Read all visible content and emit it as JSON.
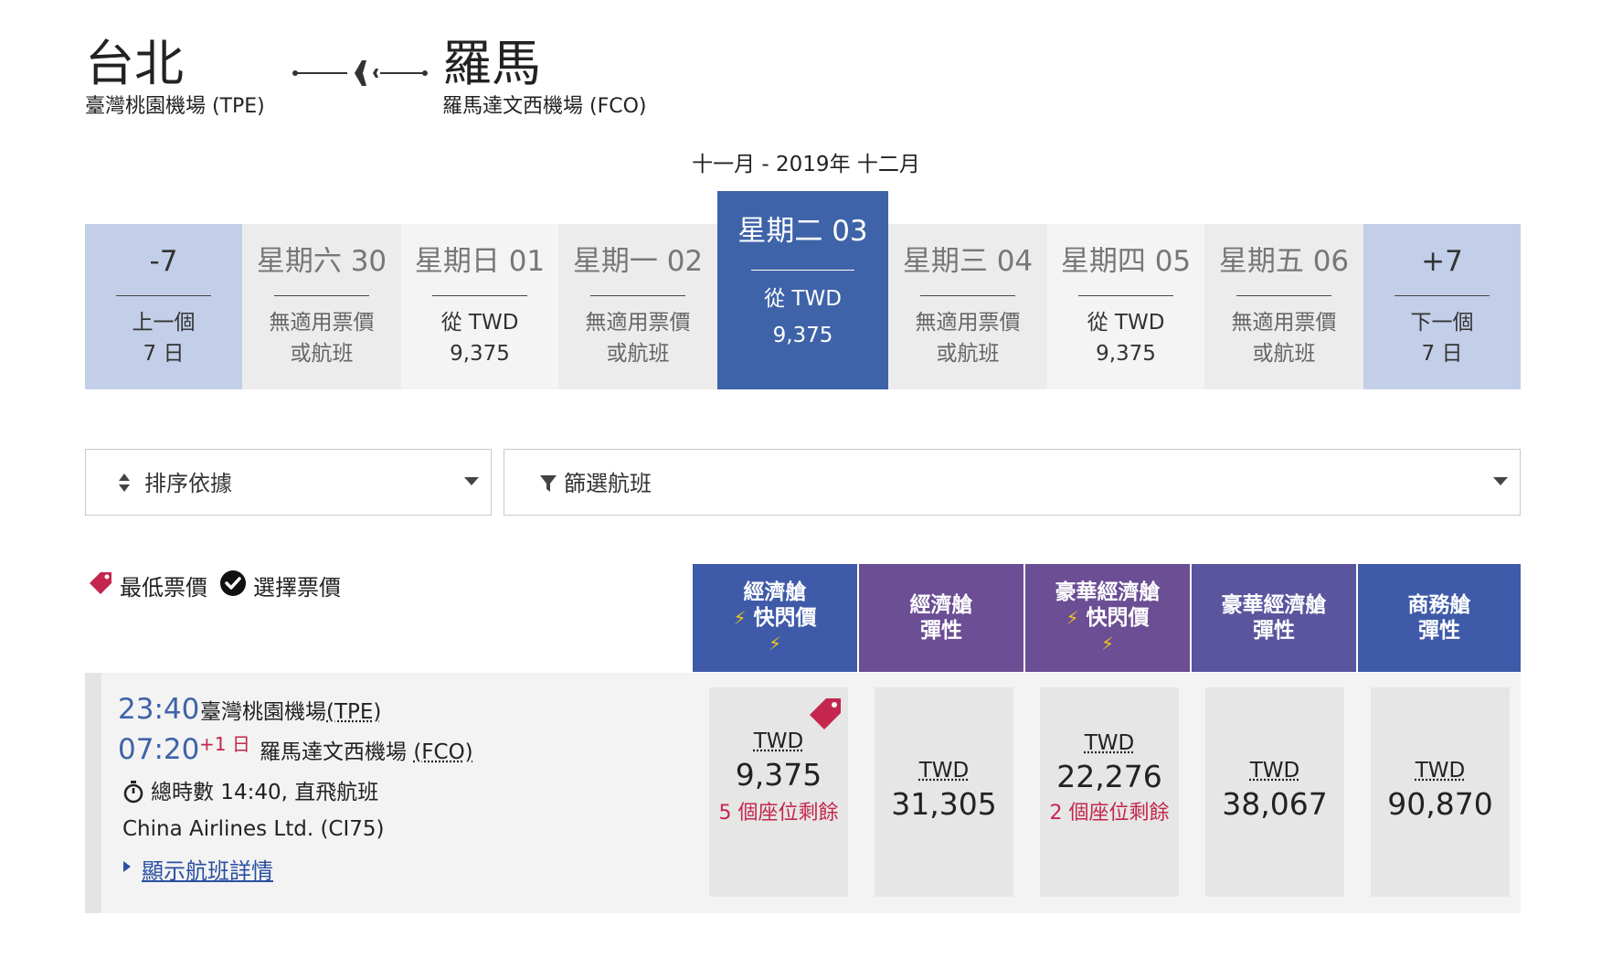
{
  "route": {
    "origin_city": "台北",
    "origin_airport": "臺灣桃園機場 (TPE)",
    "dest_city": "羅馬",
    "dest_airport": "羅馬達文西機場 (FCO)",
    "month_label": "十一月 - 2019年 十二月"
  },
  "date_strip": {
    "prev": {
      "label": "-7",
      "line1": "上一個",
      "line2": "7 日"
    },
    "next": {
      "label": "+7",
      "line1": "下一個",
      "line2": "7 日"
    },
    "days": [
      {
        "day": "星期六 30",
        "line1": "無適用票價",
        "line2": "或航班"
      },
      {
        "day": "星期日 01",
        "line1": "從 TWD",
        "line2": "9,375"
      },
      {
        "day": "星期一 02",
        "line1": "無適用票價",
        "line2": "或航班"
      },
      {
        "day": "星期二 03",
        "line1": "從 TWD",
        "line2": "9,375"
      },
      {
        "day": "星期三 04",
        "line1": "無適用票價",
        "line2": "或航班"
      },
      {
        "day": "星期四 05",
        "line1": "從 TWD",
        "line2": "9,375"
      },
      {
        "day": "星期五 06",
        "line1": "無適用票價",
        "line2": "或航班"
      }
    ]
  },
  "sort": {
    "label": "排序依據"
  },
  "filter": {
    "label": "篩選航班"
  },
  "legend": {
    "lowest_label": "最低票價",
    "selected_label": "選擇票價"
  },
  "fare_columns": [
    {
      "line1": "經濟艙",
      "line2": "快閃價",
      "color": "#3f5aa8"
    },
    {
      "line1": "經濟艙",
      "line2": "彈性",
      "color": "#6b4e94"
    },
    {
      "line1": "豪華經濟艙",
      "line2": "快閃價",
      "color": "#6b4e94"
    },
    {
      "line1": "豪華經濟艙",
      "line2": "彈性",
      "color": "#5a559d"
    },
    {
      "line1": "商務艙",
      "line2": "彈性",
      "color": "#3f5aa8"
    }
  ],
  "flight": {
    "depart_time": "23:40",
    "depart_airport_name": "臺灣桃園機場",
    "depart_airport_code": "(TPE)",
    "arrive_time": "07:20",
    "plus_day": "+1 日",
    "arrive_airport_name": "羅馬達文西機場",
    "arrive_airport_code": "(FCO)",
    "duration": "總時數 14:40, 直飛航班",
    "airline": "China Airlines Ltd. (CI75)",
    "details_link": "顯示航班詳情",
    "fares": [
      {
        "currency": "TWD",
        "amount": "9,375",
        "seats": "5 個座位剩餘"
      },
      {
        "currency": "TWD",
        "amount": "31,305"
      },
      {
        "currency": "TWD",
        "amount": "22,276",
        "seats": "2 個座位剩餘"
      },
      {
        "currency": "TWD",
        "amount": "38,067"
      },
      {
        "currency": "TWD",
        "amount": "90,870"
      }
    ]
  },
  "colors": {
    "accent_blue": "#3f63a8",
    "nav_blue": "#c3cfe9",
    "seats_red": "#c4264d",
    "tag_red": "#c4264d",
    "bolt_yellow": "#f5c518"
  },
  "icons": {
    "route": "airplane-icon",
    "sort": "sort-arrows-icon",
    "filter": "funnel-icon",
    "lowest": "price-tag-icon",
    "selected": "check-circle-icon",
    "duration": "stopwatch-icon",
    "details": "caret-right-icon",
    "flash": "lightning-icon"
  }
}
